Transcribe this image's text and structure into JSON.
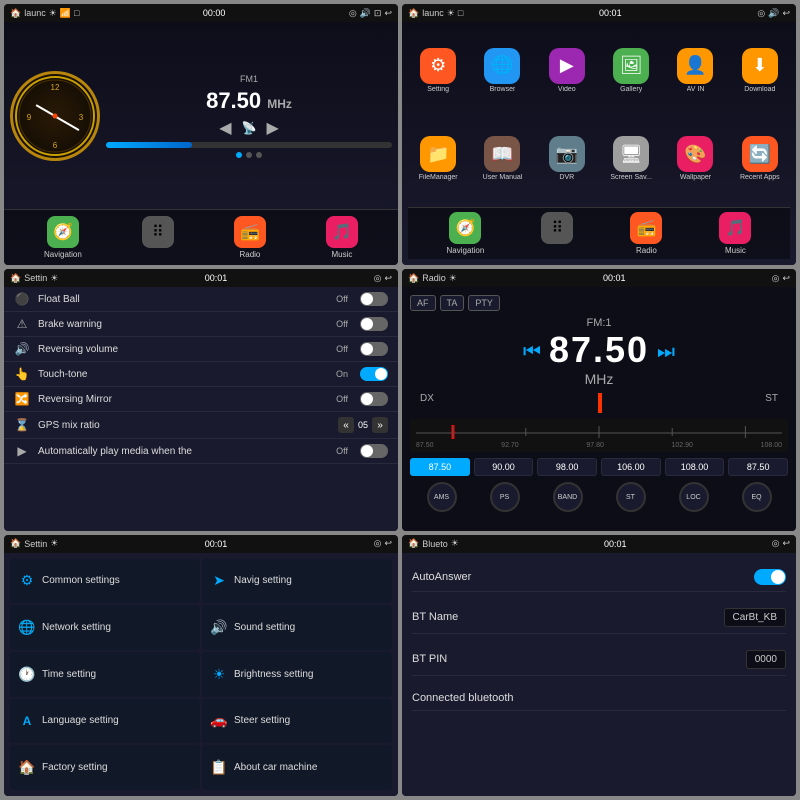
{
  "panels": [
    {
      "id": "home",
      "topbar": {
        "left": "🏠 launc",
        "center": "00:00",
        "icons": [
          "☀",
          "📶",
          "📷",
          "🔊",
          "🔲",
          "↩"
        ]
      },
      "radio": {
        "band": "FM1",
        "freq": "87.50",
        "unit": "MHz"
      },
      "apps": [
        {
          "label": "Navigation",
          "icon": "🧭",
          "color": "#4CAF50"
        },
        {
          "label": "",
          "icon": "⠿",
          "color": "#555"
        },
        {
          "label": "Radio",
          "icon": "📻",
          "color": "#FF5722"
        },
        {
          "label": "Music",
          "icon": "🎵",
          "color": "#E91E63"
        }
      ]
    },
    {
      "id": "appgrid",
      "topbar": {
        "left": "🏠 launc",
        "center": "00:01"
      },
      "grid_apps": [
        {
          "label": "Setting",
          "icon": "⚙",
          "color": "#FF5722"
        },
        {
          "label": "Browser",
          "icon": "🌐",
          "color": "#2196F3"
        },
        {
          "label": "Video",
          "icon": "▶",
          "color": "#9C27B0"
        },
        {
          "label": "Gallery",
          "icon": "🖼",
          "color": "#4CAF50"
        },
        {
          "label": "AV IN",
          "icon": "👤",
          "color": "#FF9800"
        },
        {
          "label": "Download",
          "icon": "⬇",
          "color": "#FF9800"
        },
        {
          "label": "FileManager",
          "icon": "📁",
          "color": "#FF9800"
        },
        {
          "label": "User Manual",
          "icon": "📖",
          "color": "#795548"
        },
        {
          "label": "DVR",
          "icon": "📷",
          "color": "#607D8B"
        },
        {
          "label": "Screen Sav...",
          "icon": "🖥",
          "color": "#9E9E9E"
        },
        {
          "label": "Wallpaper",
          "icon": "🎨",
          "color": "#E91E63"
        },
        {
          "label": "Recent Apps",
          "icon": "🔄",
          "color": "#FF5722"
        }
      ],
      "apps": [
        {
          "label": "Navigation",
          "icon": "🧭",
          "color": "#4CAF50"
        },
        {
          "label": "",
          "icon": "⠿",
          "color": "#555"
        },
        {
          "label": "Radio",
          "icon": "📻",
          "color": "#FF5722"
        },
        {
          "label": "Music",
          "icon": "🎵",
          "color": "#E91E63"
        }
      ]
    },
    {
      "id": "settings_list",
      "topbar": {
        "left": "🏠 Settin",
        "center": "00:01"
      },
      "rows": [
        {
          "icon": "⚫",
          "label": "Float Ball",
          "value": "Off",
          "toggle": "off"
        },
        {
          "icon": "⚠",
          "label": "Brake warning",
          "value": "Off",
          "toggle": "off"
        },
        {
          "icon": "🔊",
          "label": "Reversing volume",
          "value": "Off",
          "toggle": "off"
        },
        {
          "icon": "👆",
          "label": "Touch-tone",
          "value": "On",
          "toggle": "on"
        },
        {
          "icon": "🔀",
          "label": "Reversing Mirror",
          "value": "Off",
          "toggle": "off"
        },
        {
          "icon": "⌛",
          "label": "GPS mix ratio",
          "value": "05",
          "type": "stepper"
        },
        {
          "icon": "▶",
          "label": "Automatically play media when the",
          "value": "Off",
          "toggle": "off"
        }
      ]
    },
    {
      "id": "radio",
      "topbar": {
        "left": "🏠 Radio",
        "center": "00:01"
      },
      "tags": [
        "AF",
        "TA",
        "PTY"
      ],
      "band": "FM:1",
      "freq": "87.50",
      "unit": "MHz",
      "side_left": "DX",
      "side_right": "ST",
      "scale_labels": [
        "87.50",
        "92.70",
        "97.80",
        "102.90",
        "108.00"
      ],
      "presets": [
        "87.50",
        "90.00",
        "98.00",
        "106.00",
        "108.00",
        "87.50"
      ],
      "controls": [
        "AMS",
        "PS",
        "BAND",
        "ST",
        "LOC",
        "EQ"
      ]
    },
    {
      "id": "settings_menu",
      "topbar": {
        "left": "🏠 Settin",
        "center": "00:01"
      },
      "items": [
        {
          "icon": "⚙",
          "label": "Common settings"
        },
        {
          "icon": "➤",
          "label": "Navig setting"
        },
        {
          "icon": "🌐",
          "label": "Network setting"
        },
        {
          "icon": "🔊",
          "label": "Sound setting"
        },
        {
          "icon": "🕐",
          "label": "Time setting"
        },
        {
          "icon": "☀",
          "label": "Brightness setting"
        },
        {
          "icon": "A",
          "label": "Language setting"
        },
        {
          "icon": "🚗",
          "label": "Steer setting"
        },
        {
          "icon": "🏠",
          "label": "Factory setting"
        },
        {
          "icon": "📋",
          "label": "About car machine"
        }
      ]
    },
    {
      "id": "bluetooth",
      "topbar": {
        "left": "🏠 Blueto",
        "center": "00:01"
      },
      "rows": [
        {
          "label": "AutoAnswer",
          "type": "toggle",
          "value": "on"
        },
        {
          "label": "BT Name",
          "type": "text",
          "value": "CarBt_KB"
        },
        {
          "label": "BT PIN",
          "type": "text",
          "value": "0000"
        },
        {
          "label": "Connected bluetooth",
          "type": "none",
          "value": ""
        }
      ]
    }
  ],
  "colors": {
    "bg_dark": "#0d0d18",
    "bg_panel": "#1a1a2e",
    "accent": "#00aaff",
    "text_light": "#ffffff",
    "text_dim": "#aaaaaa",
    "toggle_on": "#00aaff",
    "toggle_off": "#666666"
  }
}
